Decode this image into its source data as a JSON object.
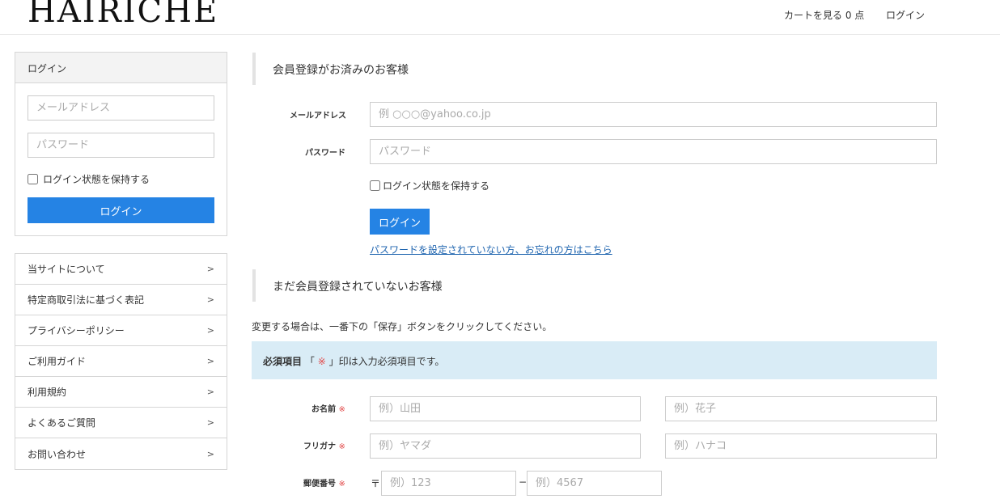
{
  "header": {
    "logo": "HAIRICHE",
    "cart_link": "カートを見る 0 点",
    "login_link": "ログイン"
  },
  "sidebar": {
    "login": {
      "title": "ログイン",
      "email_placeholder": "メールアドレス",
      "password_placeholder": "パスワード",
      "remember_label": "ログイン状態を保持する",
      "button_label": "ログイン"
    },
    "nav": [
      {
        "label": "当サイトについて",
        "arrow": ">"
      },
      {
        "label": "特定商取引法に基づく表記",
        "arrow": ">"
      },
      {
        "label": "プライバシーポリシー",
        "arrow": ">"
      },
      {
        "label": "ご利用ガイド",
        "arrow": ">"
      },
      {
        "label": "利用規約",
        "arrow": ">"
      },
      {
        "label": "よくあるご質問",
        "arrow": ">"
      },
      {
        "label": "お問い合わせ",
        "arrow": ">"
      }
    ]
  },
  "member_login": {
    "heading": "会員登録がお済みのお客様",
    "email_label": "メールアドレス",
    "email_placeholder": "例 ○○○@yahoo.co.jp",
    "password_label": "パスワード",
    "password_placeholder": "パスワード",
    "remember_label": "ログイン状態を保持する",
    "button_label": "ログイン",
    "forgot_link": "パスワードを設定されていない方、お忘れの方はこちら"
  },
  "register": {
    "heading": "まだ会員登録されていないお客様",
    "notice": "変更する場合は、一番下の「保存」ボタンをクリックしてください。",
    "required_title": "必須項目",
    "required_open": "「",
    "required_mark": "※",
    "required_text": "」印は入力必須項目です。",
    "name_label": "お名前",
    "last_name_placeholder": "例）山田",
    "first_name_placeholder": "例）花子",
    "kana_label": "フリガナ",
    "kana_last_placeholder": "例）ヤマダ",
    "kana_first_placeholder": "例）ハナコ",
    "zip_label": "郵便番号",
    "zip_mark": "〒",
    "zip1_placeholder": "例）123",
    "zip_dash": "−",
    "zip2_placeholder": "例）4567"
  },
  "colors": {
    "accent": "#2583e4",
    "required_bg": "#d9ecf6",
    "required_mark": "#e24a4a",
    "link": "#2166b0"
  }
}
